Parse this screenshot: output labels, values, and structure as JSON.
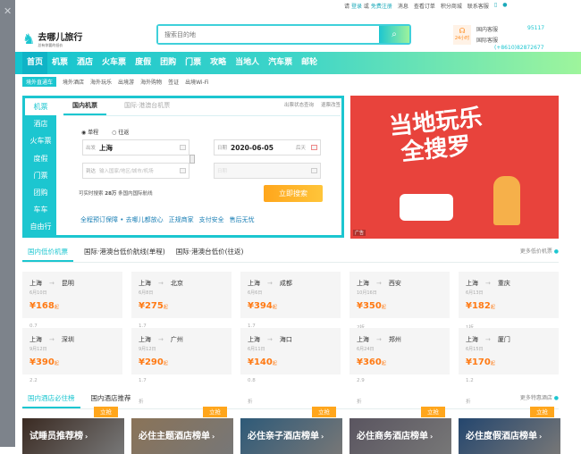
{
  "topbar": {
    "please": "请",
    "login": "登录",
    "or": "或",
    "register": "免费注册",
    "messages": "消息",
    "orders": "查看订单",
    "points": "积分商城",
    "contact": "联系客服"
  },
  "logo": {
    "name": "去哪儿旅行",
    "slogan": "总有你要的低价"
  },
  "search": {
    "placeholder": "搜索目的地"
  },
  "service": {
    "hours": "24小时",
    "domestic": "国内客服",
    "domestic_phone": "95117",
    "intl": "国际客服",
    "intl_phone": "(+8610)82872677"
  },
  "nav": [
    "首页",
    "机票",
    "酒店",
    "火车票",
    "度假",
    "团购",
    "门票",
    "攻略",
    "当地人",
    "汽车票",
    "邮轮"
  ],
  "subnav": {
    "tag": "境外直通车",
    "items": [
      "境外酒店",
      "海外玩乐",
      "出境游",
      "海外购物",
      "签证",
      "出境Wi-Fi"
    ]
  },
  "panel": {
    "side": [
      "机票",
      "酒店",
      "火车票",
      "度假",
      "门票",
      "团购",
      "车车",
      "自由行"
    ],
    "tabs": [
      "国内机票",
      "国际·港澳台机票"
    ],
    "links": [
      "出票状态查询",
      "退票改签"
    ],
    "radios": [
      "单程",
      "往返"
    ],
    "from_label": "出发",
    "from_value": "上海",
    "to_label": "到达",
    "to_placeholder": "输入国家/地区/城市/机场",
    "date_label": "日期",
    "date_value": "2020-06-05",
    "date_hint": "后天",
    "return_label": "日期",
    "tip_pre": "可实时搜索",
    "tip_num": "28万",
    "tip_post": "条国内国际航线",
    "search_btn": "立即搜索",
    "guarantees": [
      "全程预订保障 • 去哪儿都放心",
      "正规商家",
      "支付安全",
      "售后无忧"
    ]
  },
  "banner": {
    "line1": "当地玩乐",
    "line2": "全搜罗",
    "ad": "广告"
  },
  "flights": {
    "tabs": [
      "国内低价机票",
      "国际·港澳台低价航线(单程)",
      "国际·港澳台低价(往返)"
    ],
    "more": "更多低价机票",
    "cards": [
      {
        "from": "上海",
        "to": "昆明",
        "date": "6月10日",
        "price": "168",
        "disc": "0.7"
      },
      {
        "from": "上海",
        "to": "北京",
        "date": "6月8日",
        "price": "275",
        "disc": "1.7"
      },
      {
        "from": "上海",
        "to": "成都",
        "date": "6月6日",
        "price": "394",
        "disc": "1.7"
      },
      {
        "from": "上海",
        "to": "西安",
        "date": "10月16日",
        "price": "350",
        "disc": "2折"
      },
      {
        "from": "上海",
        "to": "重庆",
        "date": "6月13日",
        "price": "182",
        "disc": "1折"
      },
      {
        "from": "上海",
        "to": "深圳",
        "date": "9月12日",
        "price": "390",
        "disc": "2.2"
      },
      {
        "from": "上海",
        "to": "广州",
        "date": "9月12日",
        "price": "290",
        "disc": "1.7"
      },
      {
        "from": "上海",
        "to": "海口",
        "date": "6月11日",
        "price": "140",
        "disc": "0.8"
      },
      {
        "from": "上海",
        "to": "郑州",
        "date": "6月24日",
        "price": "360",
        "disc": "2.9"
      },
      {
        "from": "上海",
        "to": "厦门",
        "date": "6月15日",
        "price": "170",
        "disc": "1.2"
      }
    ],
    "from_suffix": "起",
    "zhe": "折"
  },
  "hotels": {
    "tabs": [
      "国内酒店必住榜",
      "国内酒店推荐"
    ],
    "more": "更多特惠酒店",
    "badge": "立抢",
    "cards": [
      "试睡员推荐榜",
      "必住主题酒店榜单",
      "必住亲子酒店榜单",
      "必住商务酒店榜单",
      "必住度假酒店榜单"
    ],
    "bg": [
      "#3a2a22",
      "#8a7358",
      "#2e5a78",
      "#5a5560",
      "#24466e"
    ]
  },
  "colors": {
    "accent": "#1cc6d0",
    "price": "#ff7a14",
    "button": "#ffa61c"
  }
}
